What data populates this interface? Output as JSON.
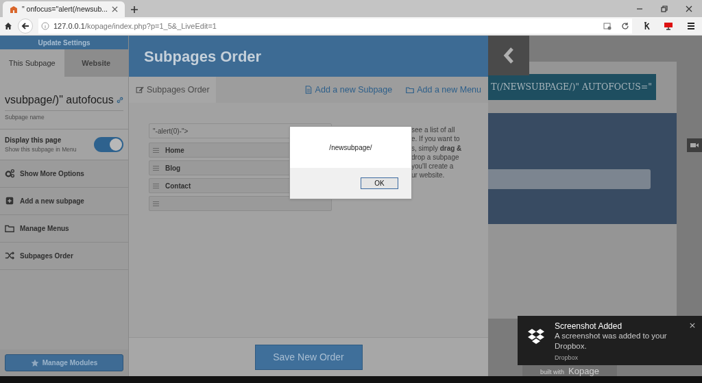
{
  "browser": {
    "tab_title": "\" onfocus=\"alert(/newsub...",
    "address_host": "127.0.0.1",
    "address_path": "/kopage/index.php?p=1_5&_LiveEdit=1"
  },
  "sidebar": {
    "header": "Update Settings",
    "tabs": [
      {
        "label": "This Subpage",
        "selected": true
      },
      {
        "label": "Website",
        "selected": false
      }
    ],
    "subpage_name": "vsubpage/)\" autofocus",
    "subpage_name_label": "Subpage name",
    "display": {
      "title": "Display this page",
      "subtitle": "Show this subpage in Menu",
      "on": true
    },
    "menu": [
      {
        "label": "Show More Options"
      },
      {
        "label": "Add a new subpage"
      },
      {
        "label": "Manage Menus"
      },
      {
        "label": "Subpages Order"
      }
    ],
    "footer_button": "Manage Modules"
  },
  "main": {
    "title": "Subpages Order",
    "tabs": [
      {
        "label": "Subpages Order",
        "selected": true
      },
      {
        "label": "Add a new Subpage",
        "selected": false
      },
      {
        "label": "Add a new Menu",
        "selected": false
      }
    ],
    "order_items": [
      {
        "kind": "plain",
        "label": "\"-alert(0)-\">"
      },
      {
        "kind": "handle",
        "label": "Home"
      },
      {
        "kind": "handle",
        "label": "Blog"
      },
      {
        "kind": "handle",
        "label": "Contact"
      },
      {
        "kind": "handle"
      }
    ],
    "help_lines": [
      "see a list of all",
      "e. If you want to",
      "s, simply **drag &**",
      "drop a subpage",
      "you'll create a",
      "ur website."
    ],
    "save_button": "Save New Order"
  },
  "preview": {
    "heading": "T(/NEWSUBPAGE/)\" AUTOFOCUS=\"",
    "footer": [
      "built with",
      "Kopage"
    ]
  },
  "dialog": {
    "message": "/newsubpage/",
    "button": "OK"
  },
  "notification": {
    "title": "Screenshot Added",
    "body": "A screenshot was added to your Dropbox.",
    "source": "Dropbox"
  }
}
